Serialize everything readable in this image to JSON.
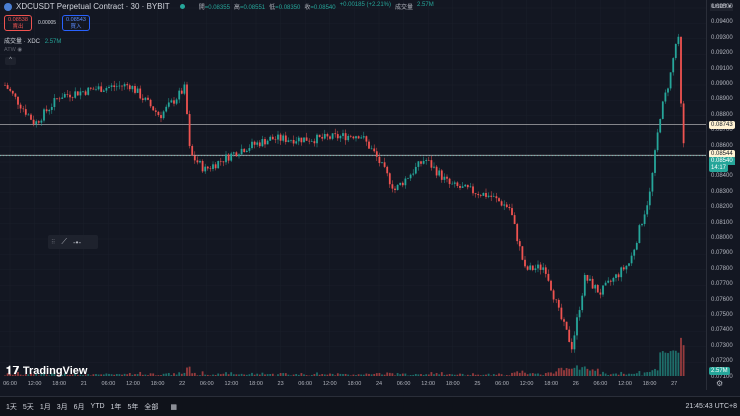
{
  "header": {
    "title": "XDCUSDT Perpetual Contract · 30 · BYBIT",
    "open_k": "開",
    "open": "0.08355",
    "high_k": "高",
    "high": "0.08551",
    "low_k": "低",
    "low": "0.08350",
    "close_k": "收",
    "close": "0.08540",
    "change": "+0.00185 (+2.21%)",
    "vol_k": "成交量",
    "vol": "2.57M"
  },
  "trade": {
    "sell_price": "0.08538",
    "sell_label": "賣出",
    "spread": "0.00005",
    "buy_price": "0.08543",
    "buy_label": "買入"
  },
  "volume_legend": {
    "label": "成交量 · XDC",
    "value": "2.57M"
  },
  "indicator": {
    "label": "ATW"
  },
  "axis": {
    "currency": "USDT",
    "labels": [
      "0.09500",
      "0.09400",
      "0.09300",
      "0.09200",
      "0.09100",
      "0.09000",
      "0.08900",
      "0.08800",
      "0.08700",
      "0.08600",
      "0.08500",
      "0.08400",
      "0.08300",
      "0.08200",
      "0.08100",
      "0.08000",
      "0.07900",
      "0.07800",
      "0.07700",
      "0.07600",
      "0.07500",
      "0.07400",
      "0.07300",
      "0.07200",
      "0.07100"
    ],
    "line1": "0.08743",
    "line2": "0.08544",
    "last": "0.08540",
    "countdown": "14:17",
    "vol_tag": "2.57M"
  },
  "lines": [
    0.08743,
    0.08544
  ],
  "time_labels": [
    "06:00",
    "12:00",
    "18:00",
    "21",
    "06:00",
    "12:00",
    "18:00",
    "22",
    "06:00",
    "12:00",
    "18:00",
    "23",
    "06:00",
    "12:00",
    "18:00",
    "24",
    "06:00",
    "12:00",
    "18:00",
    "25",
    "06:00",
    "12:00",
    "18:00",
    "26",
    "06:00",
    "12:00",
    "18:00",
    "27"
  ],
  "price_path": [
    [
      5,
      0.09
    ],
    [
      35,
      0.0875
    ],
    [
      60,
      0.0893
    ],
    [
      100,
      0.0898
    ],
    [
      130,
      0.09
    ],
    [
      160,
      0.088
    ],
    [
      185,
      0.0898
    ],
    [
      190,
      0.0855
    ],
    [
      205,
      0.0845
    ],
    [
      240,
      0.0858
    ],
    [
      270,
      0.0865
    ],
    [
      320,
      0.0865
    ],
    [
      360,
      0.0868
    ],
    [
      375,
      0.0855
    ],
    [
      395,
      0.0832
    ],
    [
      425,
      0.0852
    ],
    [
      450,
      0.0835
    ],
    [
      490,
      0.0828
    ],
    [
      510,
      0.082
    ],
    [
      525,
      0.078
    ],
    [
      545,
      0.0782
    ],
    [
      560,
      0.075
    ],
    [
      572,
      0.073
    ],
    [
      585,
      0.0775
    ],
    [
      600,
      0.0765
    ],
    [
      630,
      0.0785
    ],
    [
      650,
      0.083
    ],
    [
      660,
      0.088
    ],
    [
      670,
      0.0905
    ],
    [
      678,
      0.0935
    ],
    [
      682,
      0.087
    ],
    [
      686,
      0.0846
    ]
  ],
  "logo": "TradingView",
  "bottom": {
    "ranges": [
      "1天",
      "5天",
      "1月",
      "3月",
      "6月",
      "YTD",
      "1年",
      "5年",
      "全部"
    ],
    "clock": "21:45:43 UTC+8"
  },
  "colors": {
    "up": "#26a69a",
    "down": "#ef5350",
    "bg": "#131722"
  }
}
